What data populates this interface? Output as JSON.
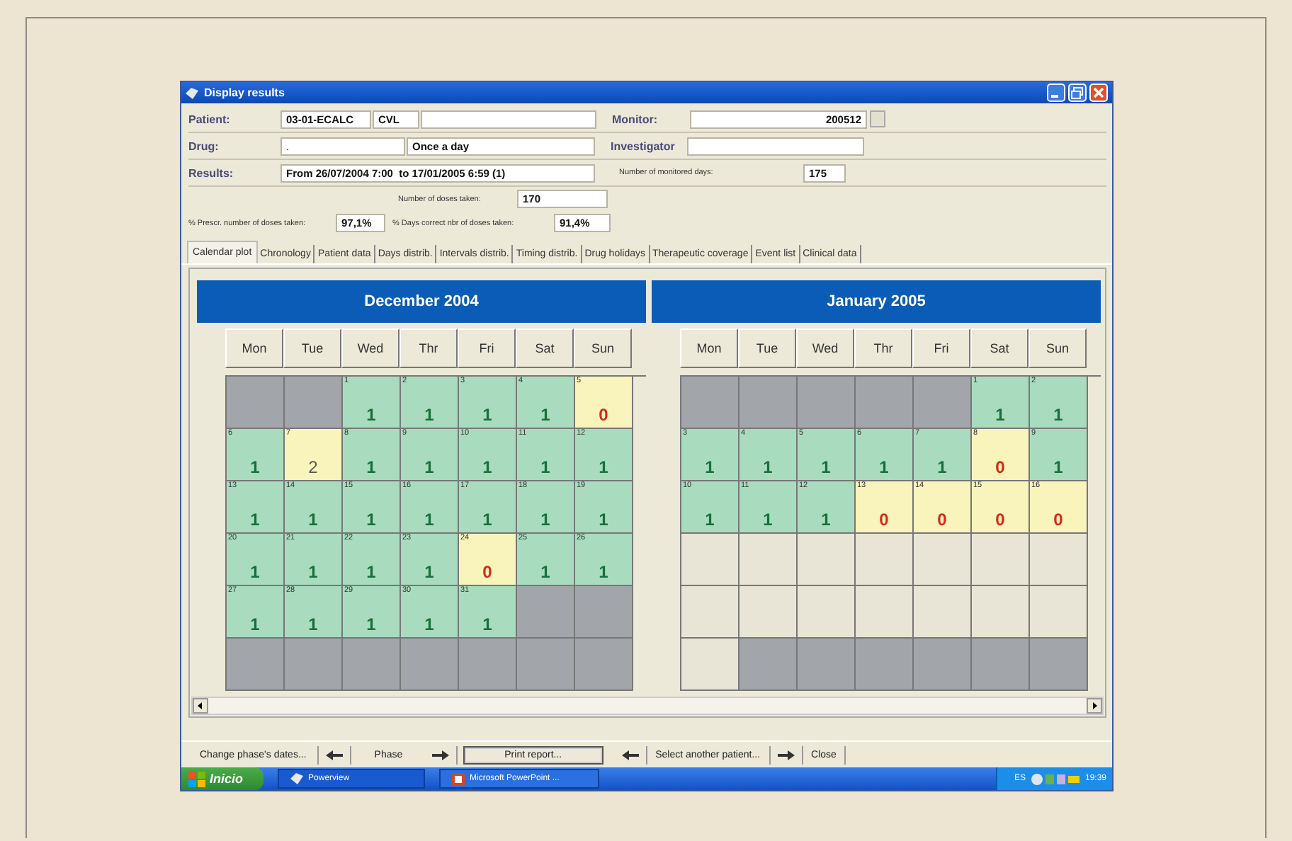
{
  "window": {
    "title": "Display results"
  },
  "form": {
    "patient_label": "Patient:",
    "patient_code": "03-01-ECALC",
    "patient_initials": "CVL",
    "monitor_label": "Monitor:",
    "monitor": "200512",
    "drug_label": "Drug:",
    "drug": ".",
    "regimen": "Once a day",
    "investigator_label": "Investigator",
    "results_label": "Results:",
    "results": "From 26/07/2004 7:00  to 17/01/2005 6:59 (1)",
    "monitored_days_label": "Number of monitored days:",
    "monitored_days": "175",
    "doses_taken_label": "Number of doses taken:",
    "doses_taken": "170",
    "prescr_label": "% Prescr. number of doses taken:",
    "prescr": "97,1%",
    "days_correct_label": "% Days correct nbr of doses taken:",
    "days_correct": "91,4%"
  },
  "tabs": [
    {
      "label": "Calendar plot",
      "selected": true
    },
    {
      "label": "Chronology",
      "selected": false
    },
    {
      "label": "Patient data",
      "selected": false
    },
    {
      "label": "Days distrib.",
      "selected": false
    },
    {
      "label": "Intervals distrib.",
      "selected": false
    },
    {
      "label": "Timing distrib.",
      "selected": false
    },
    {
      "label": "Drug holidays",
      "selected": false
    },
    {
      "label": "Therapeutic coverage",
      "selected": false
    },
    {
      "label": "Event list",
      "selected": false
    },
    {
      "label": "Clinical data",
      "selected": false
    }
  ],
  "calendars": [
    {
      "title": "December 2004",
      "weekdays": [
        "Mon",
        "Tue",
        "Wed",
        "Thr",
        "Fri",
        "Sat",
        "Sun"
      ],
      "cells": [
        {
          "kind": "off"
        },
        {
          "kind": "off"
        },
        {
          "kind": "taken",
          "day": "1",
          "count": "1"
        },
        {
          "kind": "taken",
          "day": "2",
          "count": "1"
        },
        {
          "kind": "taken",
          "day": "3",
          "count": "1"
        },
        {
          "kind": "taken",
          "day": "4",
          "count": "1"
        },
        {
          "kind": "missed",
          "day": "5",
          "count": "0"
        },
        {
          "kind": "taken",
          "day": "6",
          "count": "1"
        },
        {
          "kind": "extra",
          "day": "7",
          "count": "2"
        },
        {
          "kind": "taken",
          "day": "8",
          "count": "1"
        },
        {
          "kind": "taken",
          "day": "9",
          "count": "1"
        },
        {
          "kind": "taken",
          "day": "10",
          "count": "1"
        },
        {
          "kind": "taken",
          "day": "11",
          "count": "1"
        },
        {
          "kind": "taken",
          "day": "12",
          "count": "1"
        },
        {
          "kind": "taken",
          "day": "13",
          "count": "1"
        },
        {
          "kind": "taken",
          "day": "14",
          "count": "1"
        },
        {
          "kind": "taken",
          "day": "15",
          "count": "1"
        },
        {
          "kind": "taken",
          "day": "16",
          "count": "1"
        },
        {
          "kind": "taken",
          "day": "17",
          "count": "1"
        },
        {
          "kind": "taken",
          "day": "18",
          "count": "1"
        },
        {
          "kind": "taken",
          "day": "19",
          "count": "1"
        },
        {
          "kind": "taken",
          "day": "20",
          "count": "1"
        },
        {
          "kind": "taken",
          "day": "21",
          "count": "1"
        },
        {
          "kind": "taken",
          "day": "22",
          "count": "1"
        },
        {
          "kind": "taken",
          "day": "23",
          "count": "1"
        },
        {
          "kind": "missed",
          "day": "24",
          "count": "0"
        },
        {
          "kind": "taken",
          "day": "25",
          "count": "1"
        },
        {
          "kind": "taken",
          "day": "26",
          "count": "1"
        },
        {
          "kind": "taken",
          "day": "27",
          "count": "1"
        },
        {
          "kind": "taken",
          "day": "28",
          "count": "1"
        },
        {
          "kind": "taken",
          "day": "29",
          "count": "1"
        },
        {
          "kind": "taken",
          "day": "30",
          "count": "1"
        },
        {
          "kind": "taken",
          "day": "31",
          "count": "1"
        },
        {
          "kind": "off"
        },
        {
          "kind": "off"
        },
        {
          "kind": "off"
        },
        {
          "kind": "off"
        },
        {
          "kind": "off"
        },
        {
          "kind": "off"
        },
        {
          "kind": "off"
        },
        {
          "kind": "off"
        },
        {
          "kind": "off"
        }
      ]
    },
    {
      "title": "January 2005",
      "weekdays": [
        "Mon",
        "Tue",
        "Wed",
        "Thr",
        "Fri",
        "Sat",
        "Sun"
      ],
      "cells": [
        {
          "kind": "off"
        },
        {
          "kind": "off"
        },
        {
          "kind": "off"
        },
        {
          "kind": "off"
        },
        {
          "kind": "off"
        },
        {
          "kind": "taken",
          "day": "1",
          "count": "1"
        },
        {
          "kind": "taken",
          "day": "2",
          "count": "1"
        },
        {
          "kind": "taken",
          "day": "3",
          "count": "1"
        },
        {
          "kind": "taken",
          "day": "4",
          "count": "1"
        },
        {
          "kind": "taken",
          "day": "5",
          "count": "1"
        },
        {
          "kind": "taken",
          "day": "6",
          "count": "1"
        },
        {
          "kind": "taken",
          "day": "7",
          "count": "1"
        },
        {
          "kind": "missed",
          "day": "8",
          "count": "0"
        },
        {
          "kind": "taken",
          "day": "9",
          "count": "1"
        },
        {
          "kind": "taken",
          "day": "10",
          "count": "1"
        },
        {
          "kind": "taken",
          "day": "11",
          "count": "1"
        },
        {
          "kind": "taken",
          "day": "12",
          "count": "1"
        },
        {
          "kind": "missed",
          "day": "13",
          "count": "0"
        },
        {
          "kind": "missed",
          "day": "14",
          "count": "0"
        },
        {
          "kind": "missed",
          "day": "15",
          "count": "0"
        },
        {
          "kind": "missed",
          "day": "16",
          "count": "0"
        },
        {
          "kind": "blank"
        },
        {
          "kind": "blank"
        },
        {
          "kind": "blank"
        },
        {
          "kind": "blank"
        },
        {
          "kind": "blank"
        },
        {
          "kind": "blank"
        },
        {
          "kind": "blank"
        },
        {
          "kind": "blank"
        },
        {
          "kind": "blank"
        },
        {
          "kind": "blank"
        },
        {
          "kind": "blank"
        },
        {
          "kind": "blank"
        },
        {
          "kind": "blank"
        },
        {
          "kind": "blank"
        },
        {
          "kind": "blank"
        },
        {
          "kind": "off"
        },
        {
          "kind": "off"
        },
        {
          "kind": "off"
        },
        {
          "kind": "off"
        },
        {
          "kind": "off"
        },
        {
          "kind": "off"
        }
      ]
    }
  ],
  "bottom_bar": [
    {
      "kind": "button",
      "label": "Change phase's dates..."
    },
    {
      "kind": "prev"
    },
    {
      "kind": "label",
      "label": "Phase"
    },
    {
      "kind": "next"
    },
    {
      "kind": "default",
      "label": "Print report..."
    },
    {
      "kind": "prev"
    },
    {
      "kind": "button",
      "label": "Select another patient..."
    },
    {
      "kind": "next"
    },
    {
      "kind": "button",
      "label": "Close"
    }
  ],
  "taskbar": {
    "start": "Inicio",
    "tasks": [
      "Powerview",
      "Microsoft PowerPoint ..."
    ],
    "language": "ES",
    "clock": "19:39"
  }
}
